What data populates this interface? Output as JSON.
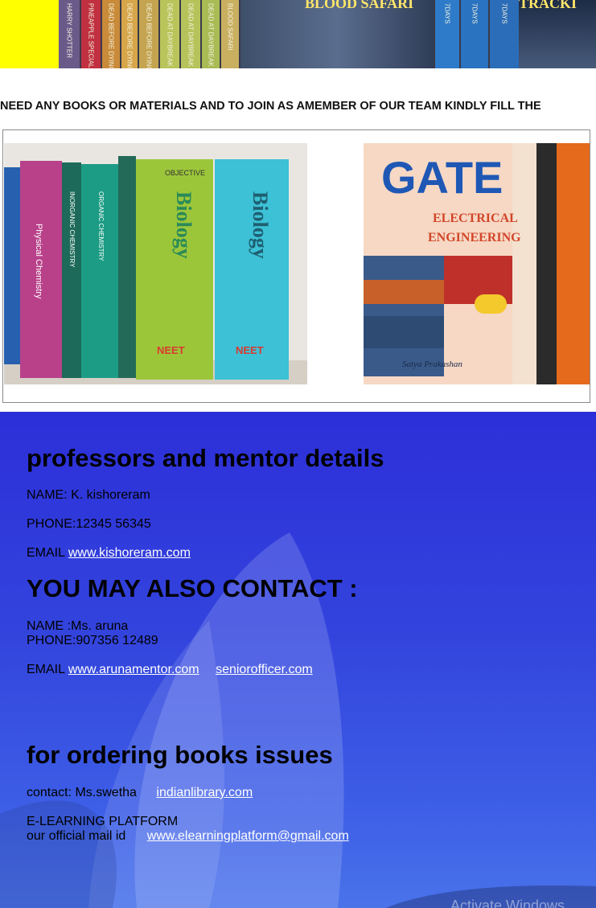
{
  "banner": {
    "title_left": "BLOOD SAFARI",
    "title_right": "TRACKI",
    "spines": [
      {
        "text": "HARRY SHOTTER",
        "color": "#6a5a8a"
      },
      {
        "text": "PINEAPPLE SPECIAL",
        "color": "#c03040"
      },
      {
        "text": "DEAD BEFORE DYING",
        "color": "#c98b3a"
      },
      {
        "text": "DEAD BEFORE DYING",
        "color": "#d7a64a"
      },
      {
        "text": "DEAD BEFORE DYING",
        "color": "#c4a450"
      },
      {
        "text": "DEAD AT DAYBREAK",
        "color": "#b9c45a"
      },
      {
        "text": "DEAD AT DAYBREAK",
        "color": "#b5c35a"
      },
      {
        "text": "DEAD AT DAYBREAK",
        "color": "#a9bb55"
      },
      {
        "text": "BLOOD SAFARI",
        "color": "#c9b060"
      },
      {
        "text": "7DAYS",
        "color": "#2e7bc9"
      },
      {
        "text": "7DAYS",
        "color": "#2a73c0"
      },
      {
        "text": "7DAYS",
        "color": "#2b6db8"
      }
    ]
  },
  "marquee": {
    "text": "NEED ANY BOOKS OR MATERIALS AND TO JOIN AS AMEMBER OF OUR TEAM KINDLY FILL THE"
  },
  "gallery": {
    "left_book_titles": [
      "OBJECTIVE",
      "Biology",
      "NEET",
      "Physical Chemistry",
      "INORGANIC CHEMISTRY",
      "ORGANIC CHEMISTRY"
    ],
    "left_spines": [
      {
        "color": "#2860b0"
      },
      {
        "color": "#b8418a"
      },
      {
        "color": "#1d6a5a"
      },
      {
        "color": "#1c9c84"
      },
      {
        "color": "#9cc63a"
      },
      {
        "color": "#3cc1d6"
      }
    ],
    "right_book": {
      "title": "GATE",
      "subtitle_1": "ELECTRICAL",
      "subtitle_2": "ENGINEERING",
      "publisher": "Satya Prakashan"
    }
  },
  "contact": {
    "heading_professors": "professors and mentor details",
    "name_1": "NAME: K. kishoreram",
    "phone_1": "PHONE:12345 56345",
    "email_label_1": "EMAIL",
    "email_link_1": "www.kishoreram.com",
    "heading_also": "YOU MAY ALSO CONTACT :",
    "name_2": "NAME :Ms. aruna",
    "phone_2": "PHONE:907356 12489",
    "email_label_2": "EMAIL",
    "email_link_2a": "www.arunamentor.com",
    "email_link_2b": "seniorofficer.com",
    "heading_ordering": "for ordering books issues",
    "contact_text": "contact: Ms.swetha",
    "contact_link": "indianlibrary.com",
    "elearning_label": "E-LEARNING PLATFORM",
    "mail_text": "our official mail id",
    "mail_link": "www.elearningplatform@gmail.com"
  },
  "watermark": "Activate Windows",
  "colors": {
    "banner_yellow": "#ffff00",
    "section_blue": "#2c2fd8",
    "link_white": "#ffffff"
  }
}
